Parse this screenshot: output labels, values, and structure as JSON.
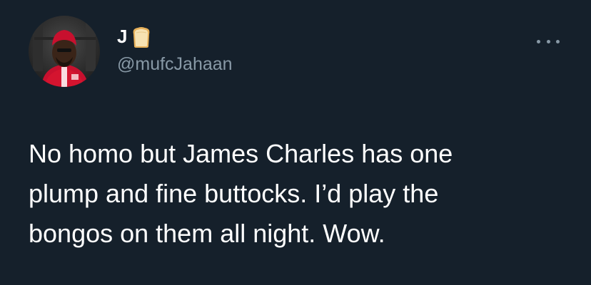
{
  "tweet": {
    "author": {
      "display_name": "J",
      "name_emoji": "bread-icon",
      "handle": "@mufcJahaan"
    },
    "text_lines": [
      "No homo but James Charles has one",
      "plump and fine buttocks. I’d play the",
      "bongos on them all night. Wow."
    ],
    "more_icon": "ellipsis-icon"
  },
  "colors": {
    "background": "#15202b",
    "text": "#ffffff",
    "secondary_text": "#8899a6"
  }
}
